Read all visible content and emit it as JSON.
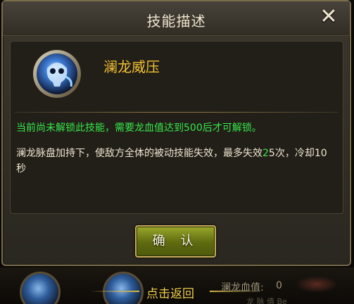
{
  "dialog": {
    "title": "技能描述",
    "close_symbol": "✕"
  },
  "skill": {
    "name": "澜龙威压",
    "icon": "blue-dragon-skull-icon",
    "lock_status": "当前尚未解锁此技能，需要龙血值达到500后才可解锁。",
    "description_pre": "澜龙脉盘加持下，使敌方全体的被动技能失效，最多失效",
    "description_num": "2",
    "description_post": "5次，冷却10秒"
  },
  "confirm_label": "确 认",
  "bottom": {
    "back_label": "点击返回",
    "blood_label": "澜龙血值:",
    "blood_value": "0",
    "faded_text": "龙 脉 值 Be"
  },
  "colors": {
    "title": "#efe6cf",
    "skill_name": "#f4c233",
    "green": "#35e84a",
    "button": "#6f7c14"
  }
}
